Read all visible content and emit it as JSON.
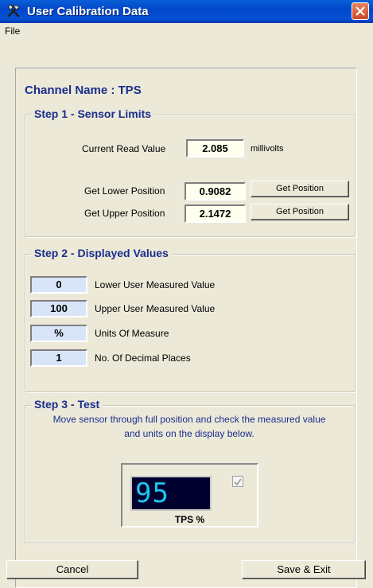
{
  "window": {
    "title": "User Calibration Data"
  },
  "menu": {
    "file": "File"
  },
  "channel": {
    "label": "Channel Name : TPS"
  },
  "step1": {
    "title": "Step 1 - Sensor Limits",
    "current_label": "Current Read Value",
    "current_value": "2.085",
    "current_unit": "millivolts",
    "lower_label": "Get Lower Position",
    "lower_value": "0.9082",
    "upper_label": "Get Upper Position",
    "upper_value": "2.1472",
    "get_position": "Get Position"
  },
  "step2": {
    "title": "Step 2 - Displayed Values",
    "rows": [
      {
        "value": "0",
        "label": "Lower User Measured Value"
      },
      {
        "value": "100",
        "label": "Upper User Measured Value"
      },
      {
        "value": "%",
        "label": "Units Of Measure"
      },
      {
        "value": "1",
        "label": "No. Of Decimal Places"
      }
    ]
  },
  "step3": {
    "title": "Step 3 - Test",
    "desc1": "Move sensor through full position and check the measured value",
    "desc2": "and units on the display below.",
    "display_value": "95",
    "display_label": "TPS %"
  },
  "buttons": {
    "cancel": "Cancel",
    "save": "Save & Exit"
  },
  "colors": {
    "accent": "#1A2E8E",
    "lcd": "#1BC7F0"
  }
}
